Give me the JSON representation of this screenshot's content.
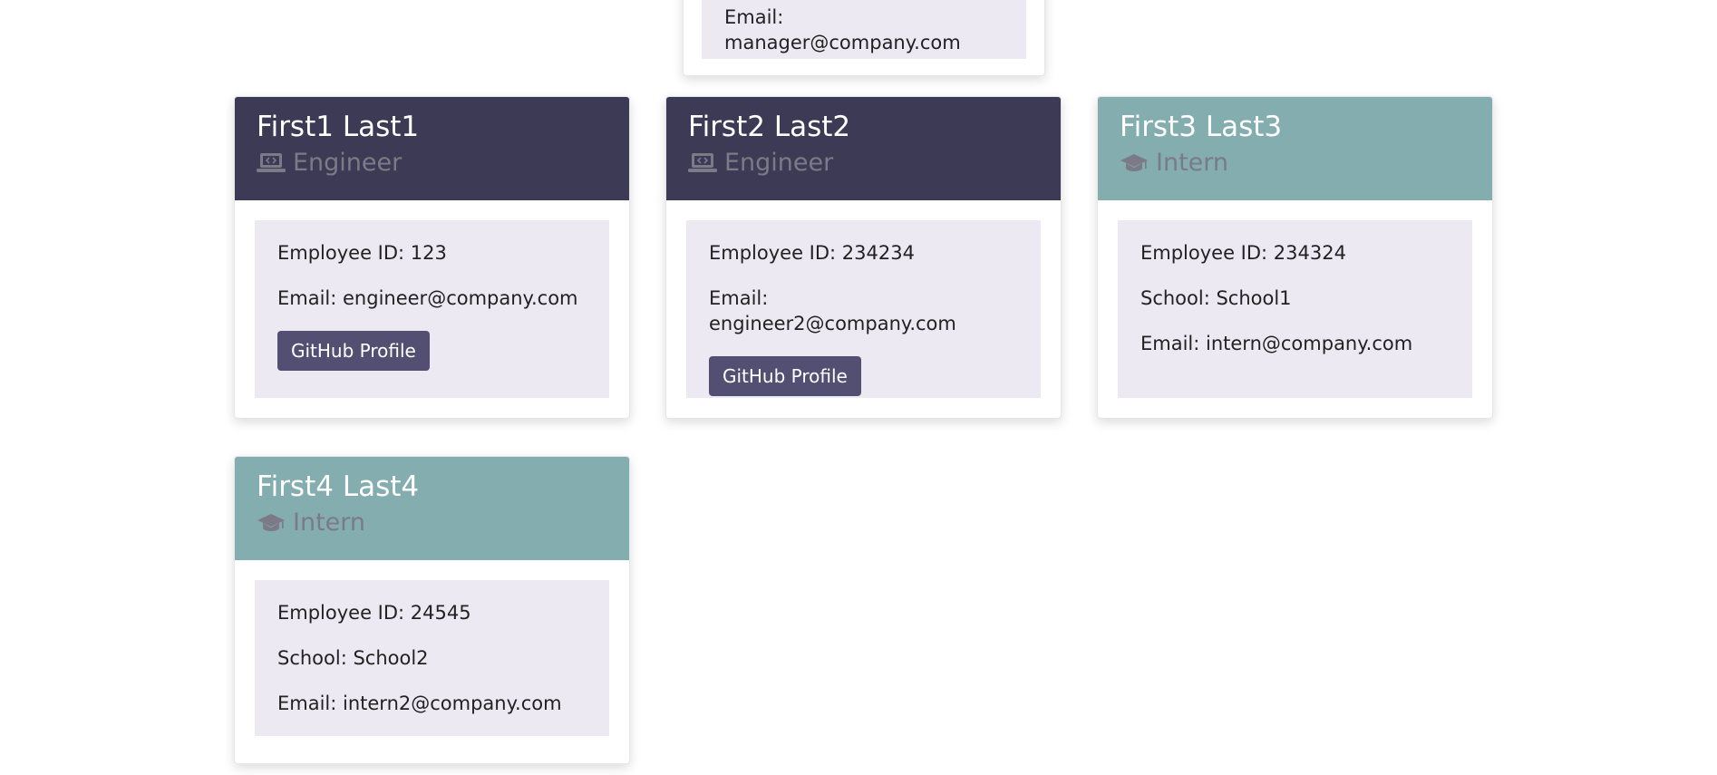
{
  "manager": {
    "email": "Email: manager@company.com"
  },
  "employees": [
    {
      "name": "First1 Last1",
      "role": "Engineer",
      "role_icon": "laptop-code-icon",
      "id_text": "Employee ID: 123",
      "email_text": "Email: engineer@company.com",
      "github_label": "GitHub Profile"
    },
    {
      "name": "First2 Last2",
      "role": "Engineer",
      "role_icon": "laptop-code-icon",
      "id_text": "Employee ID: 234234",
      "email_text": "Email: engineer2@company.com",
      "github_label": "GitHub Profile"
    },
    {
      "name": "First3 Last3",
      "role": "Intern",
      "role_icon": "graduation-cap-icon",
      "id_text": "Employee ID: 234324",
      "school_text": "School: School1",
      "email_text": "Email: intern@company.com"
    },
    {
      "name": "First4 Last4",
      "role": "Intern",
      "role_icon": "graduation-cap-icon",
      "id_text": "Employee ID: 24545",
      "school_text": "School: School2",
      "email_text": "Email: intern2@company.com"
    }
  ],
  "colors": {
    "engineer_header": "#3d3a55",
    "intern_header": "#84adaf",
    "info_background": "#ece9f2",
    "button_background": "#534f72"
  }
}
